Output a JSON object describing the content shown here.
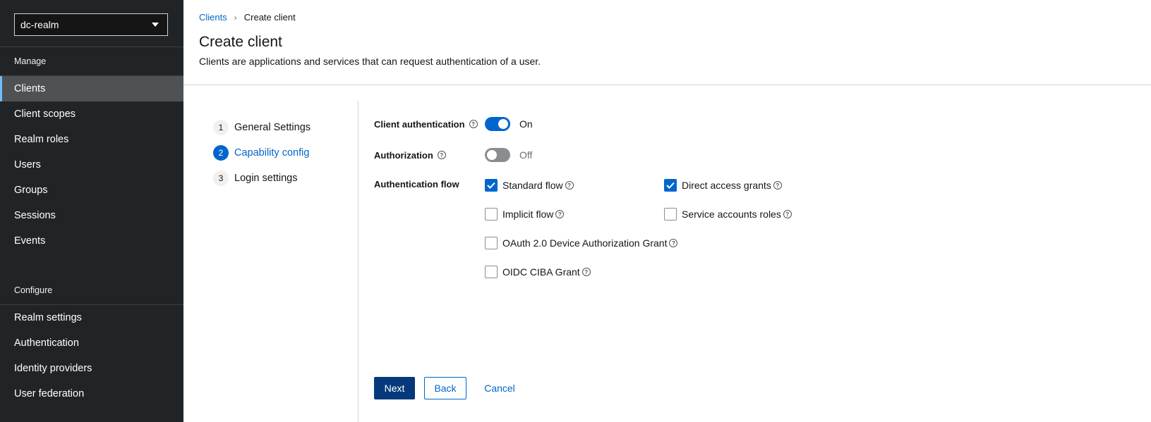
{
  "sidebar": {
    "realm": "dc-realm",
    "manage_title": "Manage",
    "manage_items": [
      {
        "label": "Clients",
        "active": true
      },
      {
        "label": "Client scopes"
      },
      {
        "label": "Realm roles"
      },
      {
        "label": "Users"
      },
      {
        "label": "Groups"
      },
      {
        "label": "Sessions"
      },
      {
        "label": "Events"
      }
    ],
    "configure_title": "Configure",
    "configure_items": [
      {
        "label": "Realm settings"
      },
      {
        "label": "Authentication"
      },
      {
        "label": "Identity providers"
      },
      {
        "label": "User federation"
      }
    ]
  },
  "breadcrumb": {
    "parent": "Clients",
    "current": "Create client"
  },
  "page": {
    "title": "Create client",
    "description": "Clients are applications and services that can request authentication of a user."
  },
  "wizard": {
    "steps": [
      {
        "num": "1",
        "label": "General Settings"
      },
      {
        "num": "2",
        "label": "Capability config",
        "current": true
      },
      {
        "num": "3",
        "label": "Login settings"
      }
    ]
  },
  "form": {
    "client_auth": {
      "label": "Client authentication",
      "state": "On"
    },
    "authorization": {
      "label": "Authorization",
      "state": "Off"
    },
    "auth_flow": {
      "label": "Authentication flow",
      "standard_flow": "Standard flow",
      "direct_access": "Direct access grants",
      "implicit_flow": "Implicit flow",
      "service_accounts": "Service accounts roles",
      "device_grant": "OAuth 2.0 Device Authorization Grant",
      "ciba_grant": "OIDC CIBA Grant"
    }
  },
  "buttons": {
    "next": "Next",
    "back": "Back",
    "cancel": "Cancel"
  },
  "colors": {
    "accent": "#0066cc",
    "primary_button": "#06397c",
    "sidebar_bg": "#212427"
  }
}
